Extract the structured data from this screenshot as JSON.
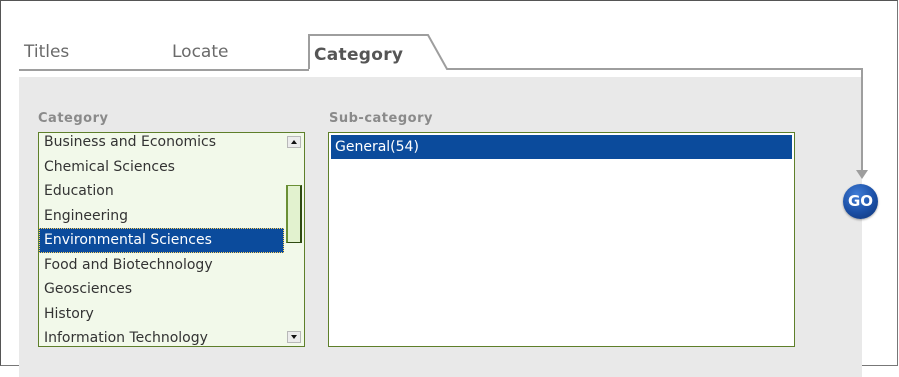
{
  "tabs": {
    "titles": "Titles",
    "locate": "Locate",
    "category": "Category"
  },
  "category": {
    "label": "Category",
    "items": [
      "Business and Economics",
      "Chemical Sciences",
      "Education",
      "Engineering",
      "Environmental Sciences",
      "Food and Biotechnology",
      "Geosciences",
      "History",
      "Information Technology"
    ],
    "selected": "Environmental Sciences"
  },
  "subcategory": {
    "label": "Sub-category",
    "items": [
      "General(54)"
    ],
    "selected": "General(54)"
  },
  "go_button": {
    "label": "GO"
  },
  "colors": {
    "selection": "#0b4b9c",
    "panel": "#e9e9e9",
    "list_border": "#5e7f2a",
    "go_button": "#1b4fa5"
  },
  "icons": {
    "scroll_up": "up-triangle",
    "scroll_down": "down-triangle",
    "connector": "down-arrow"
  }
}
